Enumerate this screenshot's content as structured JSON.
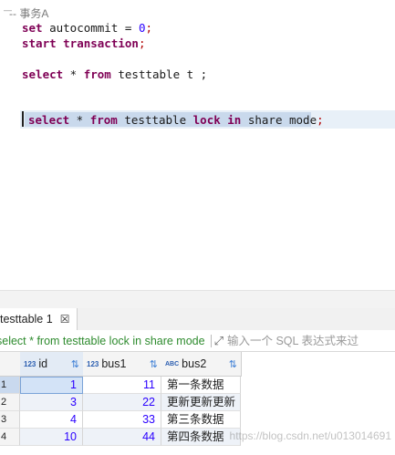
{
  "editor": {
    "comment": "-- 事务A",
    "lines": {
      "line1": {
        "kw": "set",
        "rest": " autocommit = ",
        "num": "0",
        "end": ";"
      },
      "line2": {
        "kw": "start transaction",
        "end": ";"
      },
      "line3": {
        "kw1": "select",
        "star": " * ",
        "kw2": "from",
        "rest": " testtable t ;"
      },
      "line4": {
        "kw1": "select",
        "star": " * ",
        "kw2": "from",
        "mid": " testtable ",
        "kw3": "lock in",
        "rest": " share mode",
        "end": ";"
      }
    }
  },
  "results": {
    "tab_label": "testtable 1",
    "tab_close": "☒",
    "query_text": "select * from testtable lock in share mode",
    "filter_placeholder": "输入一个 SQL 表达式来过",
    "columns": [
      {
        "type": "123",
        "name": "id"
      },
      {
        "type": "123",
        "name": "bus1"
      },
      {
        "type": "ABC",
        "name": "bus2"
      }
    ],
    "rows": [
      {
        "num": "1",
        "id": "1",
        "bus1": "11",
        "bus2": "第一条数据"
      },
      {
        "num": "2",
        "id": "3",
        "bus1": "22",
        "bus2": "更新更新更新"
      },
      {
        "num": "3",
        "id": "4",
        "bus1": "33",
        "bus2": "第三条数据"
      },
      {
        "num": "4",
        "id": "10",
        "bus1": "44",
        "bus2": "第四条数据"
      }
    ]
  },
  "watermark": "https://blog.csdn.net/u013014691",
  "colors": {
    "keyword": "#7f0055",
    "number": "#2a00ff",
    "query_text": "#2e8b2e",
    "selection": "#c9d9ec"
  },
  "icons": {
    "sort": "sort-filter-icon",
    "expand": "expand-icon",
    "tab_close": "close-icon"
  }
}
